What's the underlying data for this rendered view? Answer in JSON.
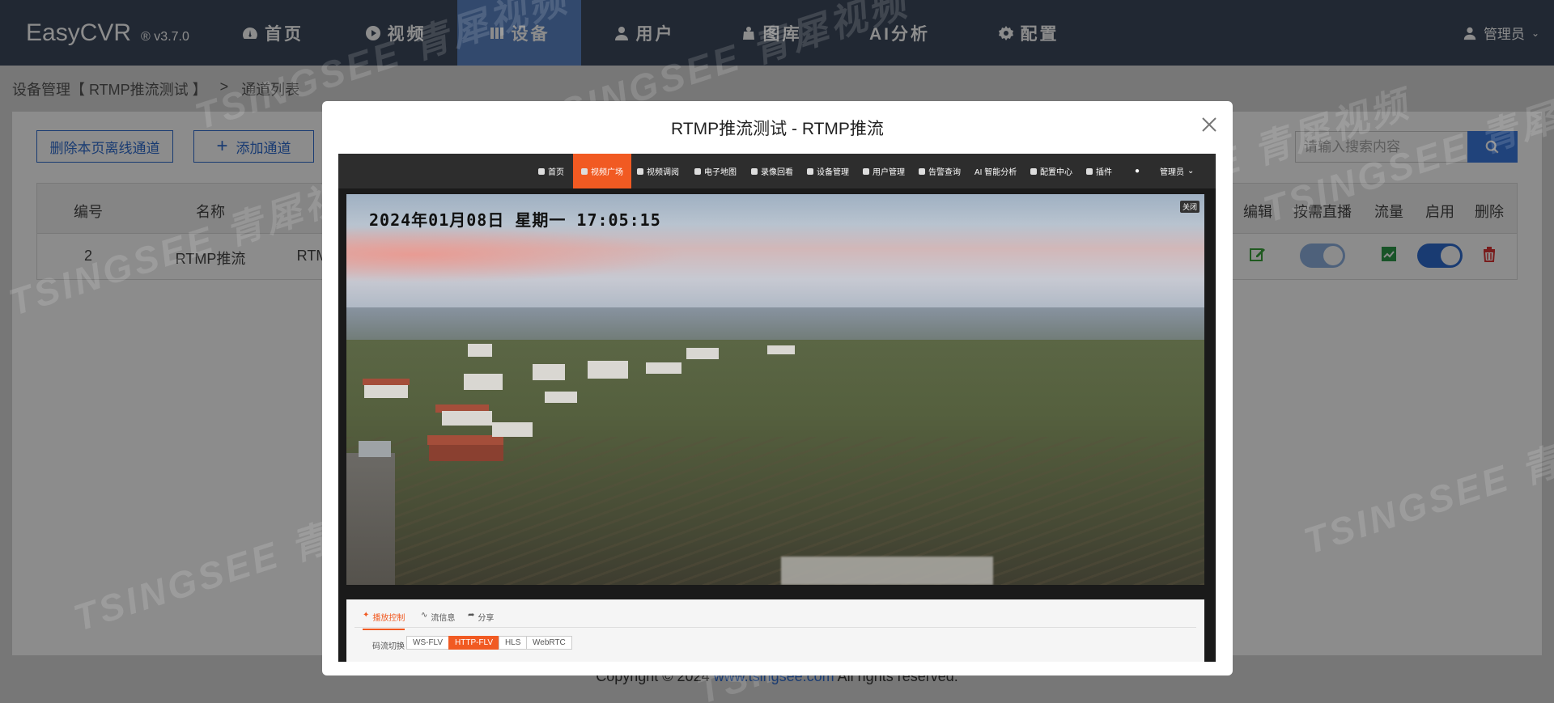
{
  "app": {
    "name": "EasyCVR",
    "version": "v3.7.0",
    "registered": "®"
  },
  "nav": {
    "items": [
      {
        "label": "首页",
        "icon": "dashboard-icon"
      },
      {
        "label": "视频",
        "icon": "play-icon"
      },
      {
        "label": "设备",
        "icon": "device-icon",
        "active": true
      },
      {
        "label": "用户",
        "icon": "user-icon"
      },
      {
        "label": "图库",
        "icon": "gallery-icon"
      },
      {
        "label": "AI分析",
        "icon": ""
      },
      {
        "label": "配置",
        "icon": "gear-icon"
      }
    ],
    "user": "管理员"
  },
  "breadcrumb": {
    "parent": "设备管理【 RTMP推流测试 】",
    "sep": ">",
    "current": "通道列表"
  },
  "toolbar": {
    "delete_offline": "删除本页离线通道",
    "add_channel": "添加通道",
    "search_placeholder": "请输入搜索内容"
  },
  "table": {
    "headers": [
      "编号",
      "名称",
      "编辑",
      "按需直播",
      "流量",
      "启用",
      "删除"
    ],
    "rows": [
      {
        "id": "2",
        "name": "RTMP推流",
        "col3": "RTM"
      }
    ]
  },
  "footer": {
    "prefix": "Copyright © 2024 ",
    "link": "www.tsingsee.com",
    "suffix": " All rights reserved."
  },
  "modal": {
    "title": "RTMP推流测试 - RTMP推流",
    "player": {
      "nav": [
        "首页",
        "视频广场",
        "视频调阅",
        "电子地图",
        "录像回看",
        "设备管理",
        "用户管理",
        "告警查询",
        "AI 智能分析",
        "配置中心",
        "插件",
        "管理员"
      ],
      "osd": "2024年01月08日  星期一  17:05:15",
      "close": "关闭",
      "tabs": [
        "播放控制",
        "流信息",
        "分享"
      ],
      "stream_label": "码流切换",
      "streams": [
        "WS-FLV",
        "HTTP-FLV",
        "HLS",
        "WebRTC"
      ],
      "active_stream": "HTTP-FLV"
    }
  },
  "colors": {
    "nav_bg": "#3c4a5e",
    "nav_active": "#5b86c6",
    "accent": "#2f6ccf",
    "player_accent": "#f15a22"
  },
  "watermark": "TSINGSEE 青犀视频"
}
